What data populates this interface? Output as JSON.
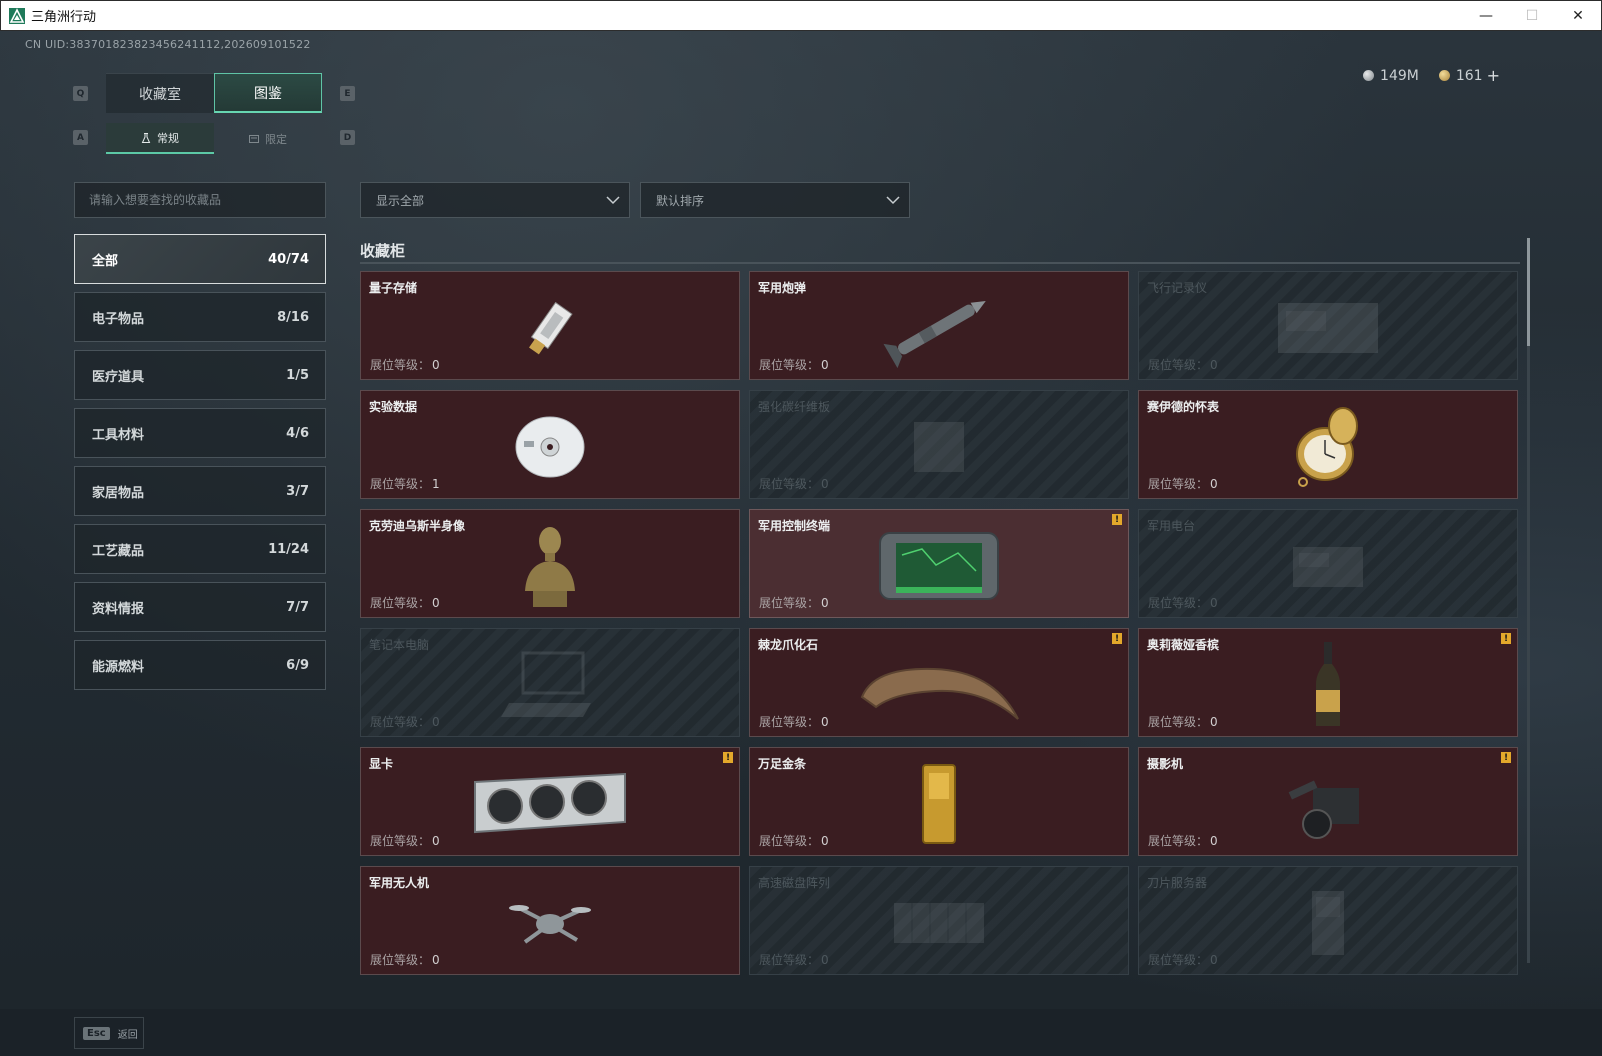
{
  "window": {
    "title": "三角洲行动",
    "minimize": "—",
    "maximize": "☐",
    "close": "✕"
  },
  "header": {
    "uid": "CN UID:383701823823456241112,202609101522"
  },
  "currency": {
    "silver": "149M",
    "gold": "161",
    "add": "+"
  },
  "hotkeys": {
    "q": "Q",
    "e": "E",
    "a": "A",
    "d": "D"
  },
  "tabs": [
    {
      "label": "收藏室",
      "active": false
    },
    {
      "label": "图鉴",
      "active": true
    }
  ],
  "subtabs": [
    {
      "label": "常规",
      "active": true,
      "icon": "flask-icon"
    },
    {
      "label": "限定",
      "active": false,
      "icon": "card-icon"
    }
  ],
  "search": {
    "placeholder": "请输入想要查找的收藏品",
    "value": ""
  },
  "categories": [
    {
      "label": "全部",
      "count": "40/74",
      "active": true
    },
    {
      "label": "电子物品",
      "count": "8/16"
    },
    {
      "label": "医疗道具",
      "count": "1/5"
    },
    {
      "label": "工具材料",
      "count": "4/6"
    },
    {
      "label": "家居物品",
      "count": "3/7"
    },
    {
      "label": "工艺藏品",
      "count": "11/24"
    },
    {
      "label": "资料情报",
      "count": "7/7"
    },
    {
      "label": "能源燃料",
      "count": "6/9"
    }
  ],
  "filters": {
    "display": "显示全部",
    "sort": "默认排序"
  },
  "section": {
    "title": "收藏柜"
  },
  "level_label": "展位等级：",
  "items": [
    {
      "name": "量子存储",
      "level": "0",
      "unlocked": true,
      "badge": false,
      "icon": "usb-drive-icon"
    },
    {
      "name": "军用炮弹",
      "level": "0",
      "unlocked": true,
      "badge": false,
      "icon": "missile-icon"
    },
    {
      "name": "飞行记录仪",
      "level": "0",
      "unlocked": false,
      "badge": false,
      "icon": "flight-recorder-icon"
    },
    {
      "name": "实验数据",
      "level": "1",
      "unlocked": true,
      "badge": false,
      "icon": "disc-icon"
    },
    {
      "name": "强化碳纤维板",
      "level": "0",
      "unlocked": false,
      "badge": false,
      "icon": "carbon-plate-icon"
    },
    {
      "name": "赛伊德的怀表",
      "level": "0",
      "unlocked": true,
      "badge": false,
      "icon": "pocket-watch-icon"
    },
    {
      "name": "克劳迪乌斯半身像",
      "level": "0",
      "unlocked": true,
      "badge": false,
      "icon": "bust-icon"
    },
    {
      "name": "军用控制终端",
      "level": "0",
      "unlocked": true,
      "badge": true,
      "highlight": true,
      "icon": "control-terminal-icon"
    },
    {
      "name": "军用电台",
      "level": "0",
      "unlocked": false,
      "badge": false,
      "icon": "radio-icon"
    },
    {
      "name": "笔记本电脑",
      "level": "0",
      "unlocked": false,
      "badge": false,
      "icon": "laptop-icon"
    },
    {
      "name": "棘龙爪化石",
      "level": "0",
      "unlocked": true,
      "badge": true,
      "icon": "claw-fossil-icon"
    },
    {
      "name": "奥莉薇娅香槟",
      "level": "0",
      "unlocked": true,
      "badge": true,
      "icon": "champagne-icon"
    },
    {
      "name": "显卡",
      "level": "0",
      "unlocked": true,
      "badge": true,
      "icon": "graphics-card-icon"
    },
    {
      "name": "万足金条",
      "level": "0",
      "unlocked": true,
      "badge": false,
      "icon": "gold-bar-icon"
    },
    {
      "name": "摄影机",
      "level": "0",
      "unlocked": true,
      "badge": true,
      "icon": "camera-icon"
    },
    {
      "name": "军用无人机",
      "level": "0",
      "unlocked": true,
      "badge": false,
      "icon": "drone-icon"
    },
    {
      "name": "高速磁盘阵列",
      "level": "0",
      "unlocked": false,
      "badge": false,
      "icon": "disk-array-icon"
    },
    {
      "name": "刀片服务器",
      "level": "0",
      "unlocked": false,
      "badge": false,
      "icon": "blade-server-icon"
    }
  ],
  "badge_text": "!",
  "footer": {
    "esc_key": "Esc",
    "back_label": "返回"
  },
  "colors": {
    "accent": "#5cc9a6",
    "card_unlocked": "#3a1d21",
    "badge": "#e3a82b"
  }
}
